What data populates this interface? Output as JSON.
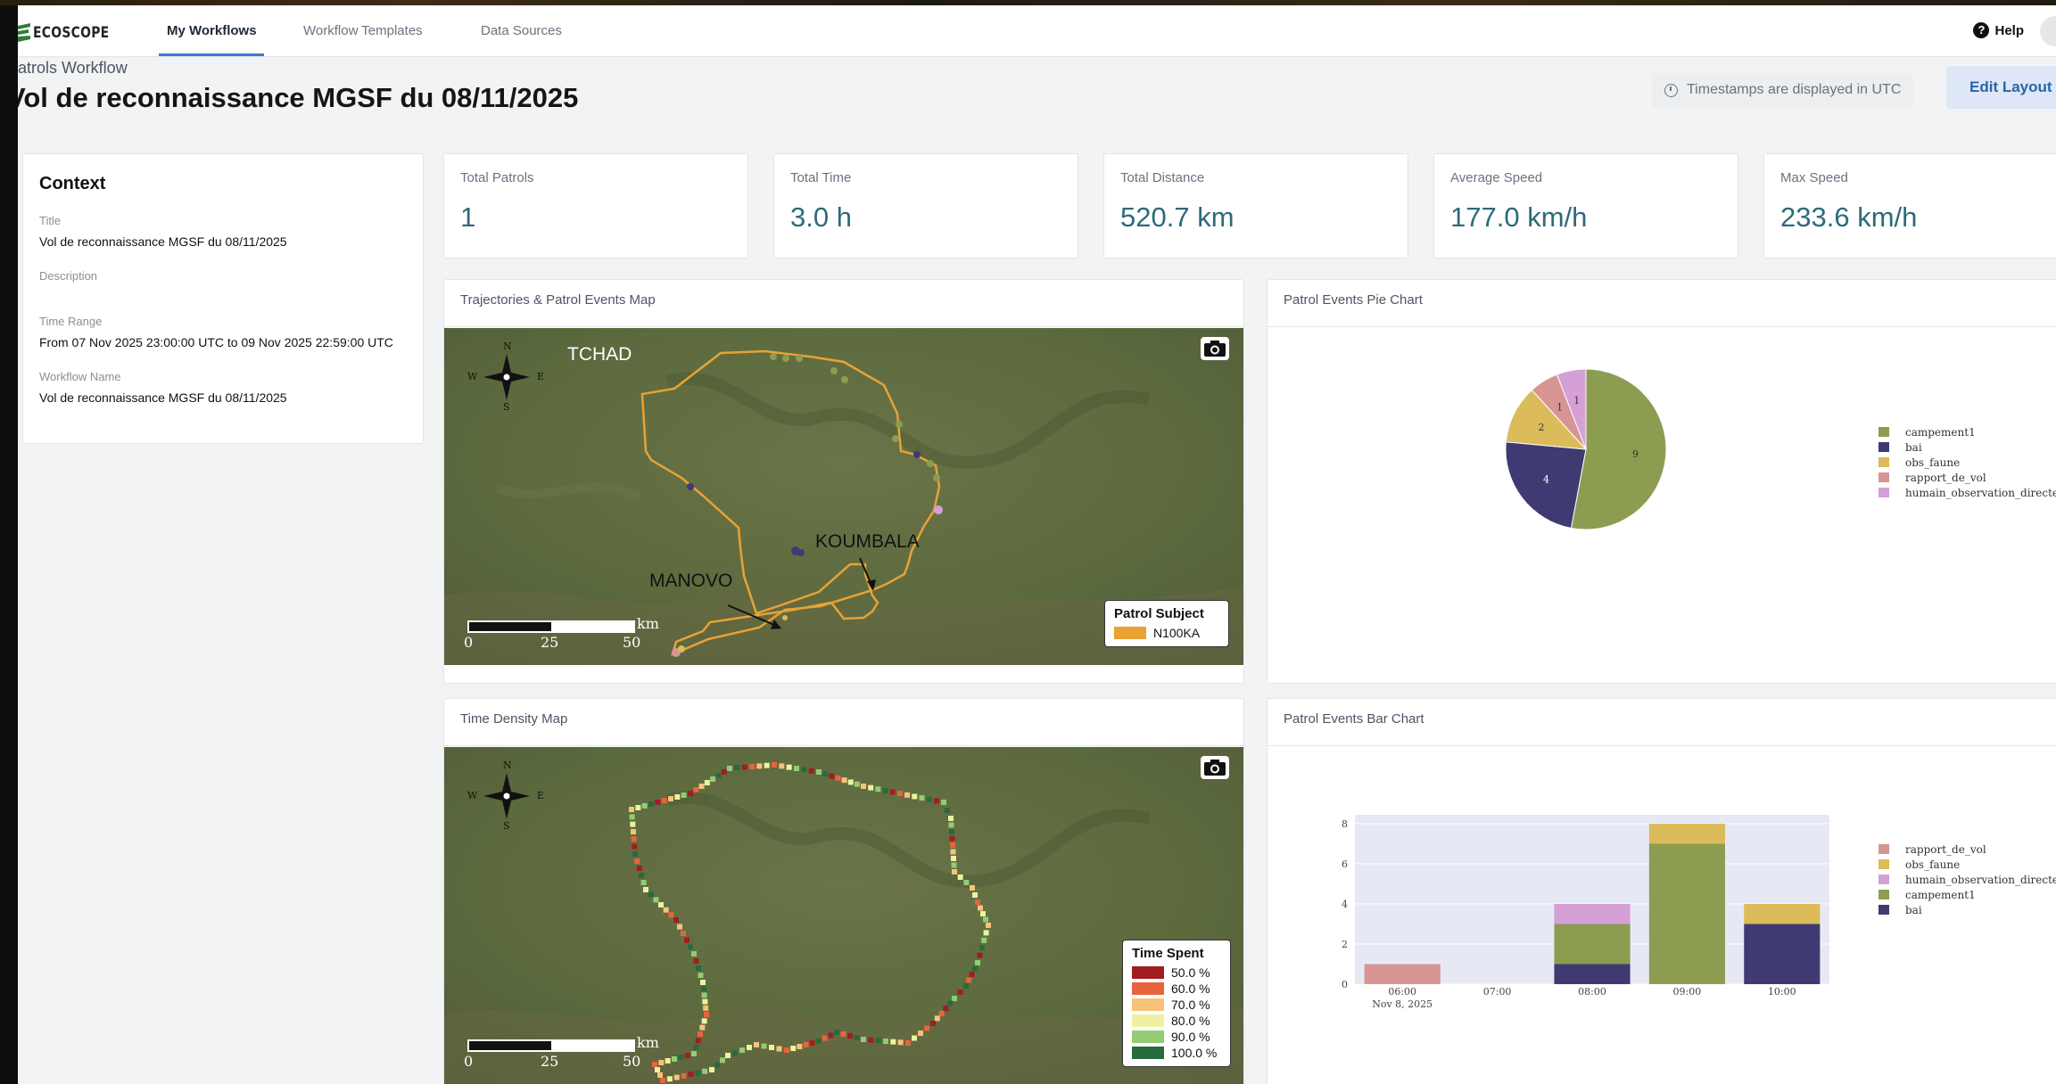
{
  "app": {
    "logo": "ECOSCOPE",
    "nav_tabs": [
      "My Workflows",
      "Workflow Templates",
      "Data Sources"
    ],
    "help": "Help"
  },
  "header": {
    "breadcrumb": "atrols Workflow",
    "title": "Vol de reconnaissance MGSF du 08/11/2025",
    "timezone_note": "Timestamps are displayed in UTC",
    "edit_layout": "Edit Layout"
  },
  "context": {
    "heading": "Context",
    "title_label": "Title",
    "title_value": "Vol de reconnaissance MGSF du 08/11/2025",
    "description_label": "Description",
    "time_range_label": "Time Range",
    "time_range_value": "From 07 Nov 2025 23:00:00 UTC to 09 Nov 2025 22:59:00 UTC",
    "workflow_name_label": "Workflow Name",
    "workflow_name_value": "Vol de reconnaissance MGSF du 08/11/2025"
  },
  "stats": [
    {
      "label": "Total Patrols",
      "value": "1"
    },
    {
      "label": "Total Time",
      "value": "3.0 h"
    },
    {
      "label": "Total Distance",
      "value": "520.7 km"
    },
    {
      "label": "Average Speed",
      "value": "177.0 km/h"
    },
    {
      "label": "Max Speed",
      "value": "233.6 km/h"
    }
  ],
  "traj_map": {
    "title": "Trajectories & Patrol Events Map",
    "labels": {
      "tchad": "TCHAD",
      "koumbala": "KOUMBALA",
      "manovo": "MANOVO"
    },
    "compass": {
      "n": "N",
      "s": "S",
      "e": "E",
      "w": "W"
    },
    "scale": {
      "unit": "km",
      "ticks": [
        "0",
        "25",
        "50"
      ]
    },
    "legend_title": "Patrol Subject",
    "legend_item": "N100KA",
    "track_color": "#e9a233"
  },
  "pie_panel": {
    "title": "Patrol Events Pie Chart"
  },
  "time_map": {
    "title": "Time Density Map",
    "compass": {
      "n": "N",
      "s": "S",
      "e": "E",
      "w": "W"
    },
    "scale": {
      "unit": "km",
      "ticks": [
        "0",
        "25",
        "50"
      ]
    },
    "legend_title": "Time Spent",
    "legend_items": [
      {
        "label": "50.0 %",
        "color": "#a11d22"
      },
      {
        "label": "60.0 %",
        "color": "#e8643c"
      },
      {
        "label": "70.0 %",
        "color": "#f7c27a"
      },
      {
        "label": "80.0 %",
        "color": "#eef2a0"
      },
      {
        "label": "90.0 %",
        "color": "#93cc74"
      },
      {
        "label": "100.0 %",
        "color": "#276b3c"
      }
    ]
  },
  "bar_panel": {
    "title": "Patrol Events Bar Chart"
  },
  "chart_data": [
    {
      "type": "pie",
      "categories": [
        "campement1",
        "bai",
        "obs_faune",
        "rapport_de_vol",
        "humain_observation_directe"
      ],
      "values": [
        9,
        4,
        2,
        1,
        1
      ],
      "colors": [
        "#8c9d52",
        "#3f3b72",
        "#dbbb5a",
        "#d69593",
        "#d5a0d6"
      ],
      "legend": "right"
    },
    {
      "type": "bar",
      "stacked": true,
      "categories": [
        "06:00",
        "07:00",
        "08:00",
        "09:00",
        "10:00"
      ],
      "x_sublabel": "Nov 8, 2025",
      "ylim": [
        0,
        8
      ],
      "yticks": [
        "0",
        "2",
        "4",
        "6",
        "8"
      ],
      "series": [
        {
          "name": "bai",
          "color": "#3f3b72",
          "values": [
            0,
            0,
            1,
            0,
            3
          ]
        },
        {
          "name": "campement1",
          "color": "#8c9d52",
          "values": [
            0,
            0,
            2,
            7,
            0
          ]
        },
        {
          "name": "humain_observation_directe",
          "color": "#d5a0d6",
          "values": [
            0,
            0,
            1,
            0,
            0
          ]
        },
        {
          "name": "obs_faune",
          "color": "#dbbb5a",
          "values": [
            0,
            0,
            0,
            1,
            1
          ]
        },
        {
          "name": "rapport_de_vol",
          "color": "#d69593",
          "values": [
            1,
            0,
            0,
            0,
            0
          ]
        }
      ],
      "legend_order": [
        "rapport_de_vol",
        "obs_faune",
        "humain_observation_directe",
        "campement1",
        "bai"
      ],
      "grid": true,
      "legend": "right"
    }
  ]
}
